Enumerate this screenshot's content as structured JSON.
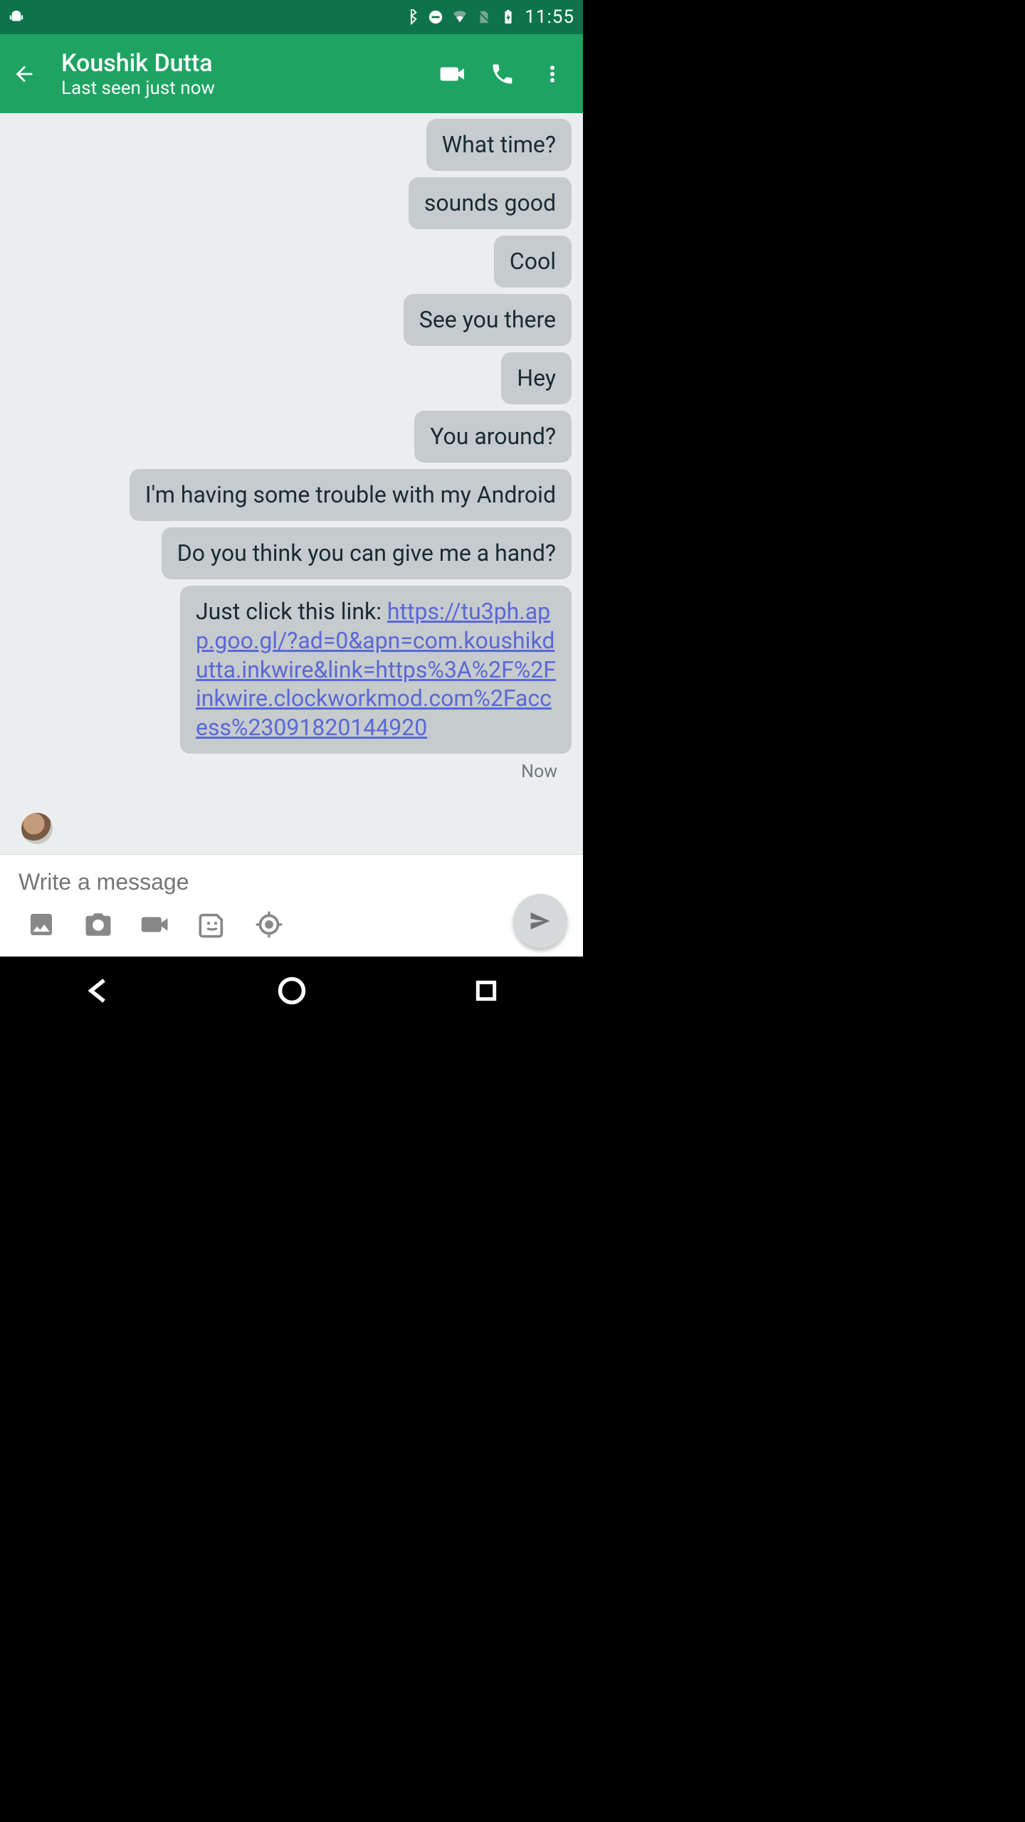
{
  "status": {
    "time": "11:55"
  },
  "header": {
    "contact_name": "Koushik Dutta",
    "last_seen": "Last seen just now"
  },
  "messages": [
    {
      "text": "What time?"
    },
    {
      "text": "sounds good"
    },
    {
      "text": "Cool"
    },
    {
      "text": "See you there"
    },
    {
      "text": "Hey"
    },
    {
      "text": "You around?"
    },
    {
      "text": "I'm having some trouble with my Android"
    },
    {
      "text": "Do you think you can give me a hand?"
    }
  ],
  "link_msg": {
    "prefix": "Just click this link: ",
    "url_text": "https://tu3ph.app.goo.gl/?ad=0&apn=com.koushikdutta.inkwire&link=https%3A%2F%2Finkwire.clockworkmod.com%2Faccess%23091820144920"
  },
  "timestamp": "Now",
  "compose": {
    "placeholder": "Write a message"
  }
}
